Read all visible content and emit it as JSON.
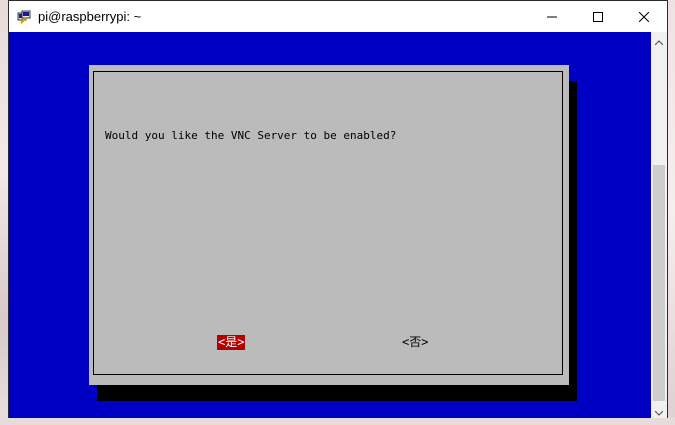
{
  "window": {
    "title": "pi@raspberrypi: ~",
    "controls": {
      "minimize": "minimize",
      "maximize": "maximize",
      "close": "close"
    }
  },
  "dialog": {
    "message": "Would you like the VNC Server to be enabled?",
    "yes_label": "<是>",
    "no_label": "<否>",
    "selected": "yes"
  },
  "colors": {
    "terminal_bg": "#0000c4",
    "dialog_bg": "#bbbbbb",
    "selected_bg": "#b30000"
  },
  "icons": [
    "putty-icon",
    "minimize-icon",
    "maximize-icon",
    "close-icon",
    "scroll-up-icon",
    "scroll-down-icon"
  ]
}
